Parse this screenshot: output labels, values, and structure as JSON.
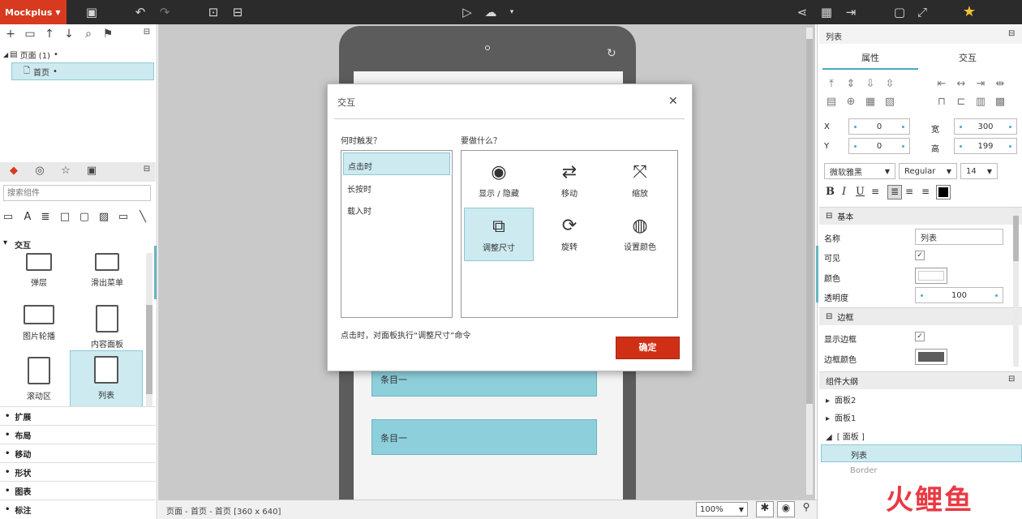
{
  "app": {
    "name": "Mockplus",
    "zoom": "100%",
    "status": "页面 - 首页 - 首页 [360 x 640]"
  },
  "left": {
    "tree": {
      "root": "页面 (1)",
      "page": "首页"
    },
    "search_placeholder": "搜索组件",
    "group_label": "交互",
    "components": [
      "弹层",
      "滑出菜单",
      "图片轮播",
      "内容面板",
      "滚动区",
      "列表"
    ],
    "categories": [
      "扩展",
      "布局",
      "移动",
      "形状",
      "图表",
      "标注"
    ]
  },
  "canvas": {
    "list_items": [
      "条目一",
      "条目一"
    ]
  },
  "dialog": {
    "title": "交互",
    "trigger_heading": "何时触发？",
    "triggers": [
      "点击时",
      "长按时",
      "载入时"
    ],
    "action_heading": "要做什么？",
    "actions": [
      {
        "label": "显示 / 隐藏",
        "icon": "eye-icon"
      },
      {
        "label": "移动",
        "icon": "move-arrows-icon"
      },
      {
        "label": "缩放",
        "icon": "scale-icon"
      },
      {
        "label": "调整尺寸",
        "icon": "resize-icon"
      },
      {
        "label": "旋转",
        "icon": "rotate-icon"
      },
      {
        "label": "设置颜色",
        "icon": "palette-icon"
      }
    ],
    "summary": "点击时，对面板执行“调整尺寸”命令",
    "ok": "确定"
  },
  "right": {
    "header": "列表",
    "tabs": [
      "属性",
      "交互"
    ],
    "x_label": "X",
    "x_value": "0",
    "y_label": "Y",
    "y_value": "0",
    "w_label": "宽",
    "w_value": "300",
    "h_label": "高",
    "h_value": "199",
    "font_family": "微软雅黑",
    "font_weight": "Regular",
    "font_size": "14",
    "section_basic": "基本",
    "name_label": "名称",
    "name_value": "列表",
    "visible_label": "可见",
    "color_label": "颜色",
    "opacity_label": "透明度",
    "opacity_value": "100",
    "section_border": "边框",
    "show_border_label": "显示边框",
    "border_color_label": "边框颜色",
    "outline_header": "组件大纲",
    "outline": [
      "面板2",
      "面板1",
      "[ 面板 ]",
      "列表",
      "Border"
    ]
  },
  "watermark": "火鲤鱼"
}
